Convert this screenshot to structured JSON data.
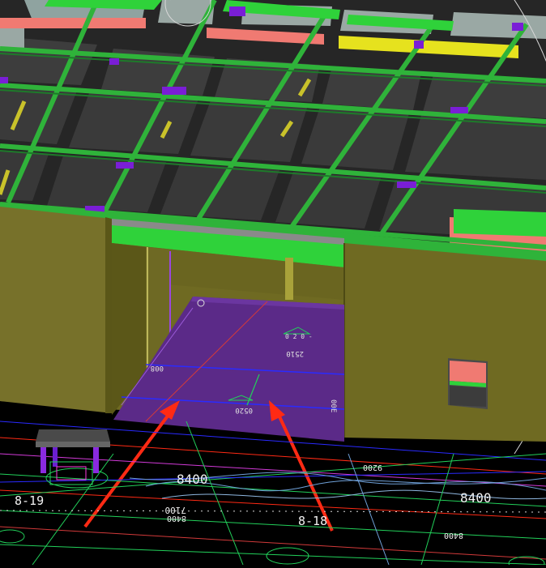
{
  "viewport": {
    "colors": {
      "background": "#000000",
      "ceiling_panel": "#3b3b3b",
      "beam_green": "#2fb33a",
      "duct_pink": "#f07a72",
      "duct_yellow": "#e6e21e",
      "bracket_purple": "#7a1ed6",
      "wall_olive": "#6f6a22",
      "floor_purple": "#5b2a88",
      "annotation_green": "#22d05a",
      "arrow_red": "#ff2a14"
    },
    "dimension_labels": {
      "left_8400": "8400",
      "right_8400": "8400",
      "left_axis_ref": "8-19",
      "center_axis_ref": "8-18",
      "mirrored_7100": "7100",
      "mirrored_8400a": "8400",
      "mirrored_8400b": "8400",
      "mirrored_9200": "9200",
      "floor_mark_1": "008",
      "floor_mark_2": "0520",
      "floor_mark_3": "2510",
      "floor_mark_4": "00E"
    },
    "markers": {
      "orbit_gizmo_icon": "orbit-circle",
      "arrow_icon": "red-arrow"
    }
  }
}
